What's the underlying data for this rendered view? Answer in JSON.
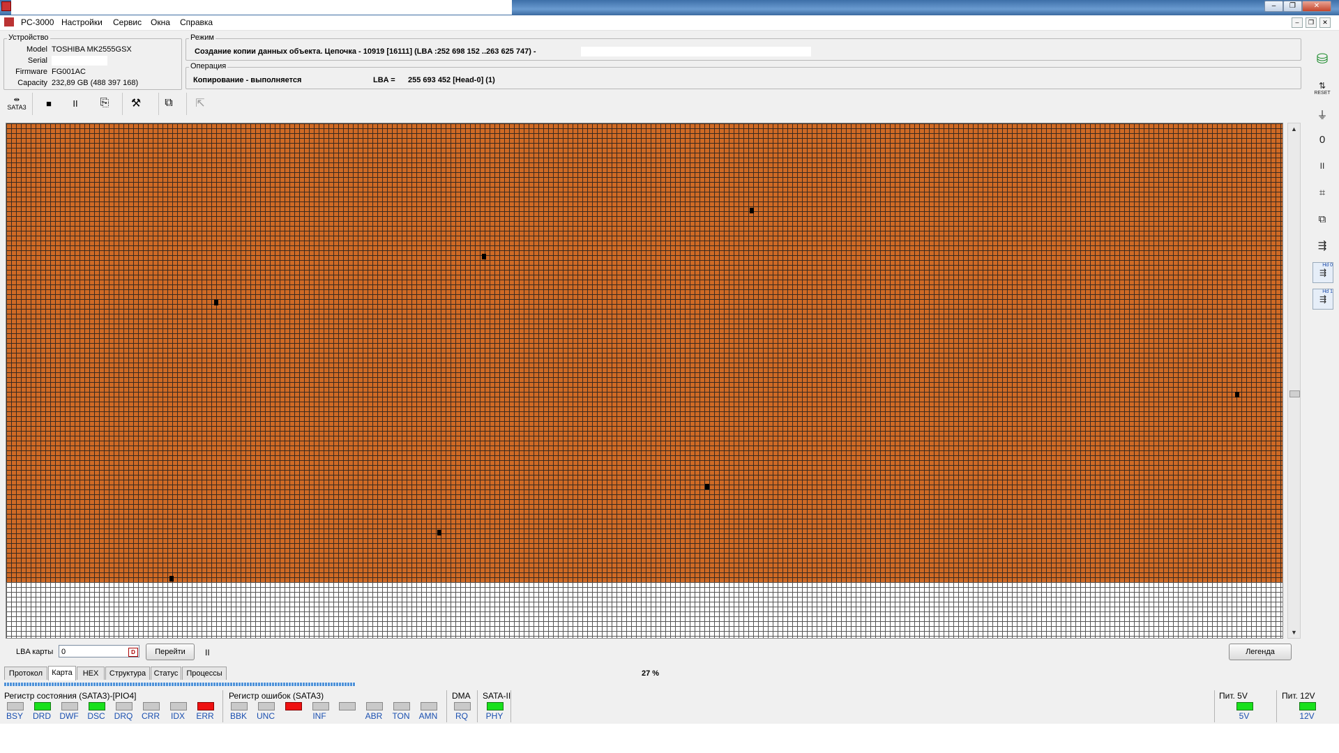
{
  "app": {
    "title": "PC-3000"
  },
  "menu": [
    "Настройки",
    "Сервис",
    "Окна",
    "Справка"
  ],
  "window_controls": {
    "minimize": "–",
    "restore": "❐",
    "close": "✕"
  },
  "device": {
    "group_title": "Устройство",
    "labels": {
      "model": "Model",
      "serial": "Serial",
      "firmware": "Firmware",
      "capacity": "Capacity"
    },
    "model": "TOSHIBA MK2555GSX",
    "serial": "",
    "firmware": "FG001AC",
    "capacity": "232,89 GB (488 397 168)"
  },
  "mode": {
    "group_title": "Режим",
    "text": "Создание копии данных объекта. Цепочка - 10919 [16111] (LBA :252 698 152 ..263 625 747) -"
  },
  "operation": {
    "group_title": "Операция",
    "status": "Копирование - выполняется",
    "lba_label": "LBA =",
    "lba_value": "255 693 452  [Head-0] (1)"
  },
  "toolbar": {
    "sata_label": "SATA3",
    "stop": "■",
    "pause": "II"
  },
  "right_toolbar": {
    "reset_label": "RESET",
    "hd0": "Hd 0",
    "hd1": "Hd 1",
    "pause": "II"
  },
  "map": {
    "filled_fraction": 0.89
  },
  "bottom": {
    "lba_map_label": "LBA карты",
    "lba_map_value": "0",
    "go_button": "Перейти",
    "pause": "II",
    "legend_button": "Легенда",
    "percent": "27 %"
  },
  "tabs": [
    {
      "label": "Протокол",
      "active": false
    },
    {
      "label": "Карта",
      "active": true
    },
    {
      "label": "HEX",
      "active": false
    },
    {
      "label": "Структура",
      "active": false
    },
    {
      "label": "Статус",
      "active": false
    },
    {
      "label": "Процессы",
      "active": false
    }
  ],
  "status_register": {
    "title": "Регистр состояния (SATA3)-[PIO4]",
    "bits": [
      {
        "label": "BSY",
        "state": "off"
      },
      {
        "label": "DRD",
        "state": "on"
      },
      {
        "label": "DWF",
        "state": "off"
      },
      {
        "label": "DSC",
        "state": "on"
      },
      {
        "label": "DRQ",
        "state": "off"
      },
      {
        "label": "CRR",
        "state": "off"
      },
      {
        "label": "IDX",
        "state": "off"
      },
      {
        "label": "ERR",
        "state": "err"
      }
    ]
  },
  "error_register": {
    "title": "Регистр ошибок  (SATA3)",
    "bits": [
      {
        "label": "BBK",
        "state": "off"
      },
      {
        "label": "UNC",
        "state": "off"
      },
      {
        "label": "",
        "state": "err"
      },
      {
        "label": "INF",
        "state": "off"
      },
      {
        "label": "",
        "state": "off"
      },
      {
        "label": "ABR",
        "state": "off"
      },
      {
        "label": "TON",
        "state": "off"
      },
      {
        "label": "AMN",
        "state": "off"
      }
    ]
  },
  "dma": {
    "title": "DMA",
    "label": "RQ"
  },
  "sata": {
    "title": "SATA-II",
    "label": "PHY"
  },
  "power5": {
    "title": "Пит. 5V",
    "label": "5V"
  },
  "power12": {
    "title": "Пит. 12V",
    "label": "12V"
  }
}
